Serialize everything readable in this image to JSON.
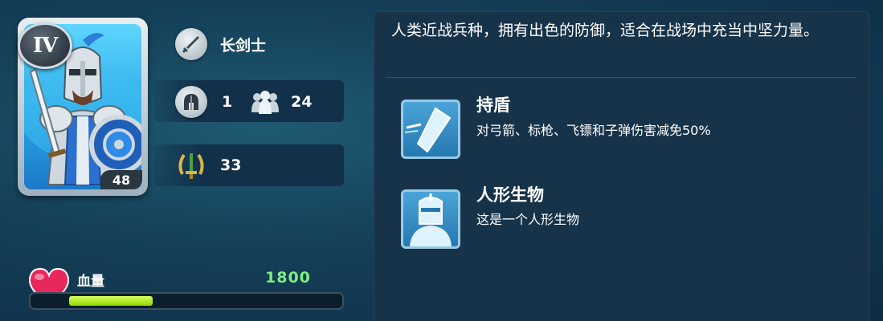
{
  "unit": {
    "name": "长剑士",
    "tier": "IV",
    "level": "48",
    "icon": "sword-icon"
  },
  "stats": {
    "armor_value": "1",
    "squad_size": "24",
    "attack_value": "33"
  },
  "health": {
    "label": "血量",
    "value": "1800",
    "fill_fraction": 0.31
  },
  "description": "人类近战兵种，拥有出色的防御，适合在战场中充当中坚力量。",
  "skills": [
    {
      "title": "持盾",
      "desc": "对弓箭、标枪、飞镖和子弹伤害减免50%",
      "icon": "shield-skill-icon"
    },
    {
      "title": "人形生物",
      "desc": "这是一个人形生物",
      "icon": "humanoid-icon"
    }
  ],
  "colors": {
    "health_text": "#7cf07f",
    "health_bar": "#a8e81a",
    "panel_bg": "#173349"
  }
}
